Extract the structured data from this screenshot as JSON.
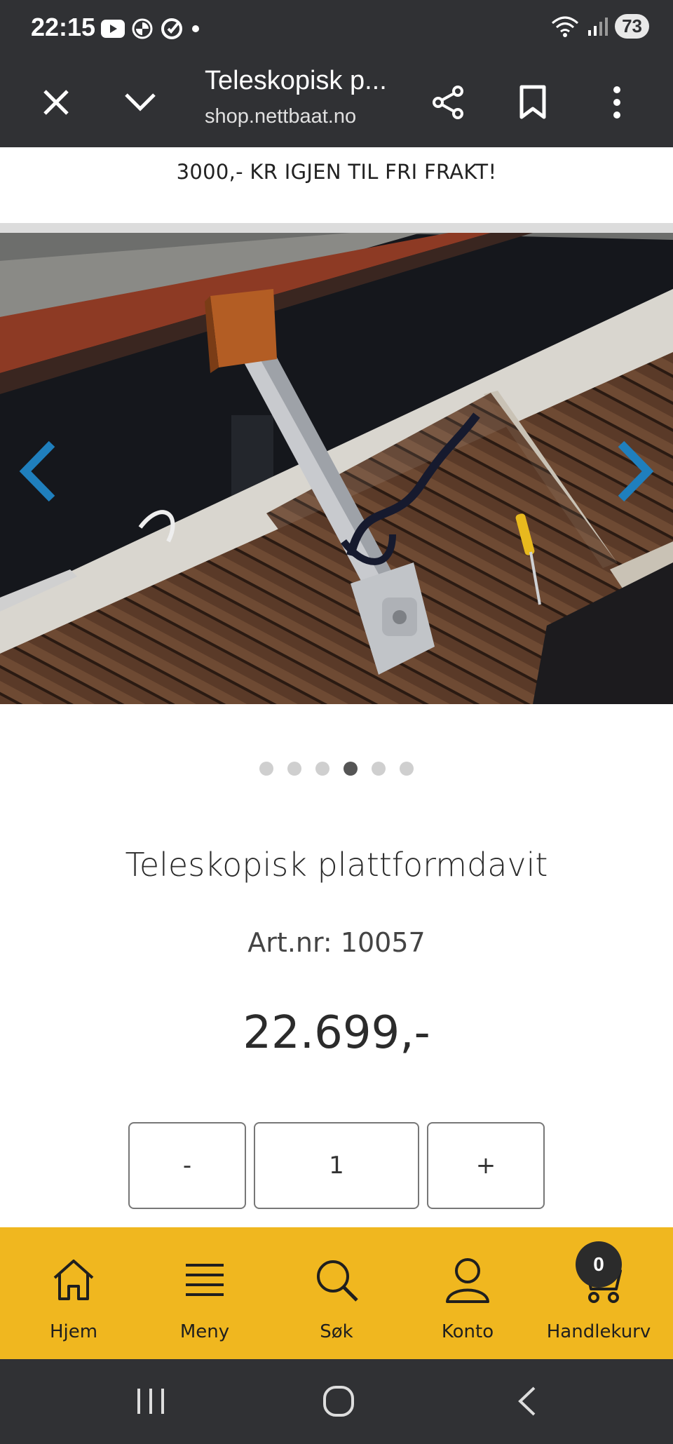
{
  "status_bar": {
    "time": "22:15",
    "battery": "73",
    "icons_left": [
      "youtube-icon",
      "bmw-icon",
      "sync-icon",
      "dot-icon"
    ],
    "icons_right": [
      "wifi-icon",
      "signal-icon",
      "battery-icon"
    ]
  },
  "browser": {
    "title": "Teleskopisk p...",
    "url": "shop.nettbaat.no"
  },
  "banner": {
    "text": "3000,- KR IGJEN TIL FRI FRAKT!"
  },
  "carousel": {
    "total": 6,
    "active_index": 3
  },
  "product": {
    "title": "Teleskopisk plattformdavit",
    "article_number": "Art.nr: 10057",
    "price": "22.699,-"
  },
  "quantity": {
    "minus_label": "-",
    "value": "1",
    "plus_label": "+"
  },
  "bottom_nav": {
    "items": [
      {
        "label": "Hjem",
        "icon": "home-icon"
      },
      {
        "label": "Meny",
        "icon": "menu-icon"
      },
      {
        "label": "Søk",
        "icon": "search-icon"
      },
      {
        "label": "Konto",
        "icon": "account-icon"
      },
      {
        "label": "Handlekurv",
        "icon": "cart-icon"
      }
    ],
    "cart_count": "0"
  },
  "colors": {
    "accent": "#f0b71f",
    "browser_bar": "#303134",
    "carousel_arrow": "#1f7fbd"
  }
}
